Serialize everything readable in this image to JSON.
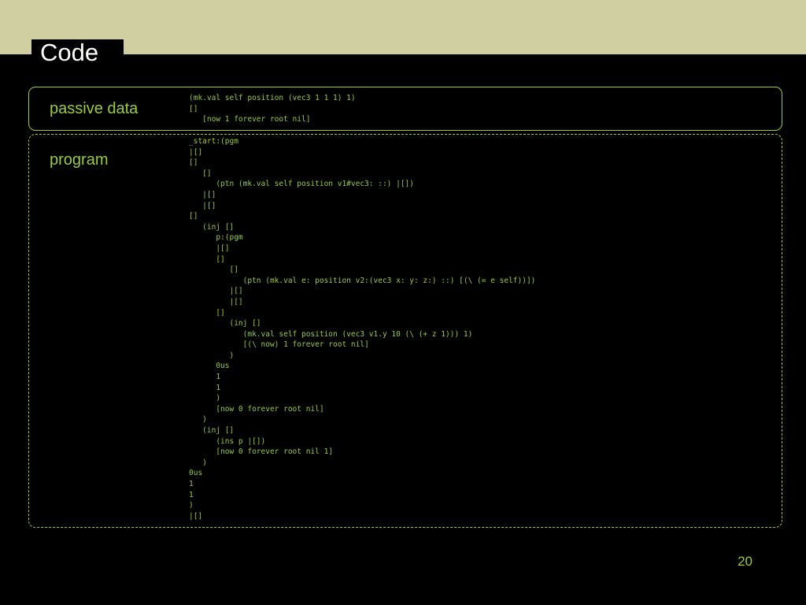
{
  "slide": {
    "title": "Code",
    "page_number": "20"
  },
  "colors": {
    "background": "#000000",
    "header_band": "#cfcfa1",
    "accent_green": "#9ccc3c",
    "title_text": "#ffffff"
  },
  "passive": {
    "label": "passive data",
    "code": "(mk.val self position (vec3 1 1 1) 1)\n[]\n   [now 1 forever root nil]"
  },
  "program": {
    "label": "program",
    "code": "_start:(pgm\n|[]\n[]\n   []\n      (ptn (mk.val self position v1#vec3: ::) |[])\n   |[]\n   |[]\n[]\n   (inj []\n      p:(pgm\n      |[]\n      []\n         []\n            (ptn (mk.val e: position v2:(vec3 x: y: z:) ::) [(\\ (= e self))])\n         |[]\n         |[]\n      []\n         (inj []\n            (mk.val self position (vec3 v1.y 10 (\\ (+ z 1))) 1)\n            [(\\ now) 1 forever root nil]\n         )\n      0us\n      1\n      1\n      )\n      [now 0 forever root nil]\n   )\n   (inj []\n      (ins p |[])\n      [now 0 forever root nil 1]\n   )\n0us\n1\n1\n)\n|[]"
  }
}
